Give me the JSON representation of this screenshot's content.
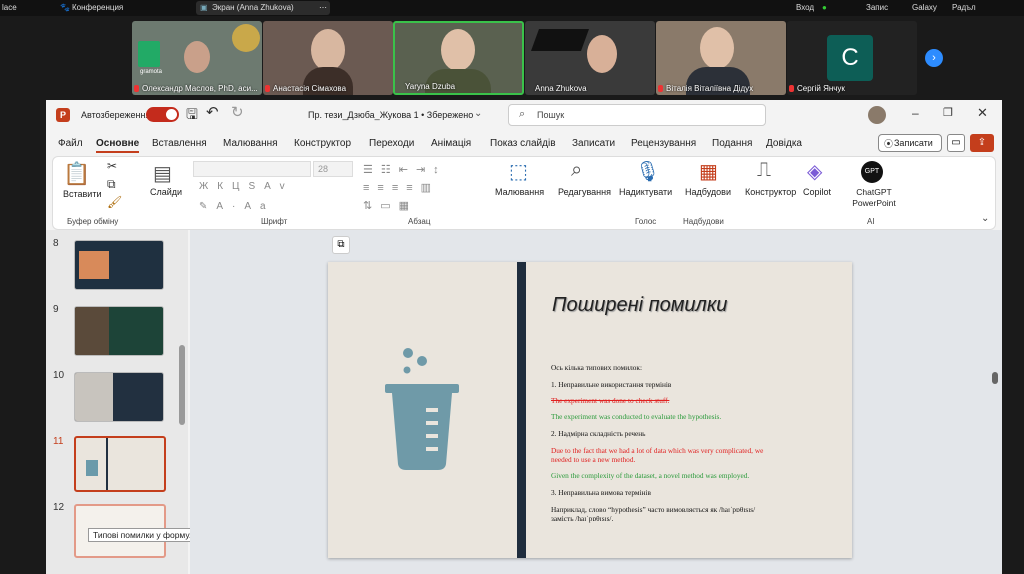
{
  "topbar": {
    "left": "lace",
    "app": "Конференция",
    "screen": "Экран (Anna Zhukova)",
    "login": "Вход",
    "r1": "Запис",
    "r2": "Galaxy",
    "r3": "Радъл"
  },
  "zoom": {
    "participants": [
      {
        "name": "Олександр Маслов, PhD, аси...",
        "bg": "#6d7a70"
      },
      {
        "name": "Анастасія Сімахова",
        "bg": "#6b5a52"
      },
      {
        "name": "Yaryna Dzuba",
        "bg": "#5a6150"
      },
      {
        "name": "Anna Zhukova",
        "bg": "#3a3a3a"
      },
      {
        "name": "Віталія Віталіївна Дідух",
        "bg": "#8a7a6a"
      },
      {
        "name": "Сергій Янчук",
        "initial": "C",
        "bg": "#222"
      }
    ],
    "logo": "gramota"
  },
  "ppt": {
    "autosave": "Автозбереження",
    "toggle": "Увімк",
    "doc_title": "Пр. тези_Дзюба_Жукова 1 • Збережено",
    "search": "Пошук",
    "tabs": [
      "Файл",
      "Основне",
      "Вставлення",
      "Малювання",
      "Конструктор",
      "Переходи",
      "Анімація",
      "Показ слайдів",
      "Записати",
      "Рецензування",
      "Подання",
      "Довідка"
    ],
    "record": "Записати",
    "ribbon": {
      "paste": "Вставити",
      "slides": "Слайди",
      "clipboard": "Буфер обміну",
      "font": "Шрифт",
      "paragraph": "Абзац",
      "font_size": "28",
      "draw": "Малювання",
      "edit": "Редагування",
      "dictate": "Надиктувати",
      "voice": "Голос",
      "addins": "Надбудови",
      "addins_group": "Надбудови",
      "designer": "Конструктор",
      "copilot": "Copilot",
      "chatgpt": "ChatGPT PowerPoint",
      "chatgpt_logo": "GPT",
      "ai": "AI"
    },
    "thumbs": [
      "8",
      "9",
      "10",
      "11",
      "12"
    ],
    "tooltip": "Типові помилки у формулюванні ...",
    "slide": {
      "title": "Поширені помилки",
      "lines": [
        {
          "text": "Ось кілька типових помилок:",
          "c": "blk"
        },
        {
          "text": "1.      Неправильне використання термінів",
          "c": "blk"
        },
        {
          "text": "The experiment was done to check stuff.",
          "c": "red strike"
        },
        {
          "text": "The experiment was conducted to evaluate the hypothesis.",
          "c": "green"
        },
        {
          "text": "2. Надмірна складність речень",
          "c": "blk"
        },
        {
          "text": "Due to the fact that we had a lot of data which was very complicated, we",
          "c": "red"
        },
        {
          "text": "needed to use a new method.",
          "c": "red"
        },
        {
          "text": "Given the complexity of the dataset, a novel method was employed.",
          "c": "green"
        },
        {
          "text": "3. Неправильна вимова термінів",
          "c": "blk"
        },
        {
          "text": " Наприклад, слово “hypothesis” часто вимовляється як /haɪˈpɒθɪsɪs/",
          "c": "blk"
        },
        {
          "text": "замість /haɪˈpɒθɪsɪs/.",
          "c": "blk"
        }
      ]
    }
  }
}
